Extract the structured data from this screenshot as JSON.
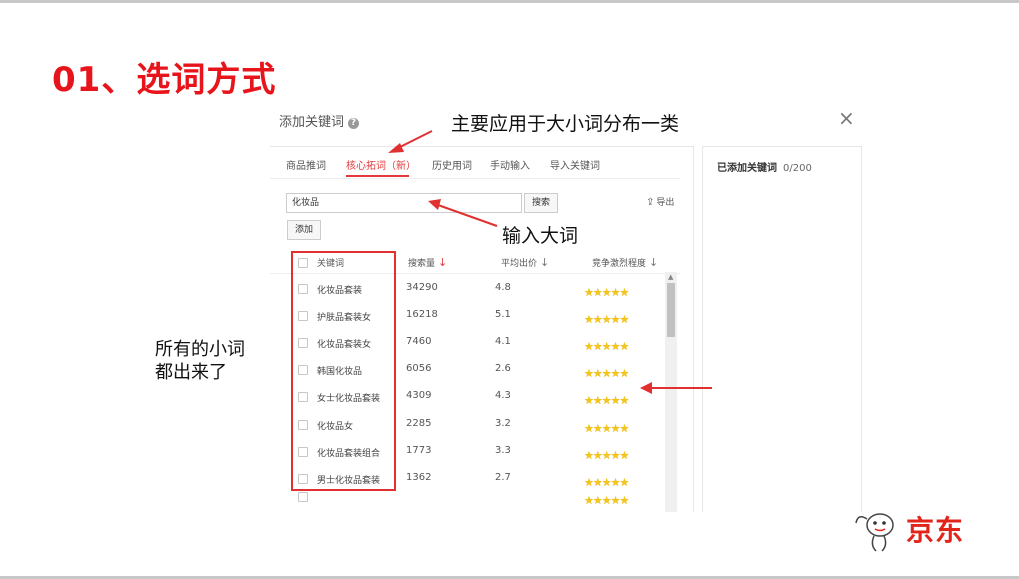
{
  "slide": {
    "title": "01、选词方式"
  },
  "dialog": {
    "title": "添加关键词",
    "help_icon": "?",
    "close_icon": "×",
    "tabs": [
      {
        "label": "商品推词",
        "active": false
      },
      {
        "label": "核心拓词（新）",
        "active": true
      },
      {
        "label": "历史用词",
        "active": false
      },
      {
        "label": "手动输入",
        "active": false
      },
      {
        "label": "导入关键词",
        "active": false
      }
    ],
    "search": {
      "value": "化妆品"
    },
    "buttons": {
      "search": "搜索",
      "add": "添加",
      "export": "导出"
    },
    "table": {
      "headers": [
        "关键词",
        "搜索量",
        "平均出价",
        "竞争激烈程度"
      ],
      "rows": [
        {
          "keyword": "化妆品套装",
          "search_volume": "34290",
          "avg_bid": "4.8",
          "competition_stars": 5
        },
        {
          "keyword": "护肤品套装女",
          "search_volume": "16218",
          "avg_bid": "5.1",
          "competition_stars": 5
        },
        {
          "keyword": "化妆品套装女",
          "search_volume": "7460",
          "avg_bid": "4.1",
          "competition_stars": 5
        },
        {
          "keyword": "韩国化妆品",
          "search_volume": "6056",
          "avg_bid": "2.6",
          "competition_stars": 5
        },
        {
          "keyword": "女士化妆品套装",
          "search_volume": "4309",
          "avg_bid": "4.3",
          "competition_stars": 5
        },
        {
          "keyword": "化妆品女",
          "search_volume": "2285",
          "avg_bid": "3.2",
          "competition_stars": 5
        },
        {
          "keyword": "化妆品套装组合",
          "search_volume": "1773",
          "avg_bid": "3.3",
          "competition_stars": 5
        },
        {
          "keyword": "男士化妆品套装",
          "search_volume": "1362",
          "avg_bid": "2.7",
          "competition_stars": 5
        }
      ]
    },
    "added": {
      "label": "已添加关键词",
      "count": "0/200"
    }
  },
  "annotations": {
    "main": "主要应用于大小词分布一类",
    "input": "输入大词",
    "left_line1": "所有的小词",
    "left_line2": "都出来了"
  },
  "logo": {
    "text": "京东"
  },
  "colors": {
    "accent": "#e4393c",
    "title_red": "#e8141b",
    "star": "#f5c518",
    "annotation_red": "#e03030"
  }
}
